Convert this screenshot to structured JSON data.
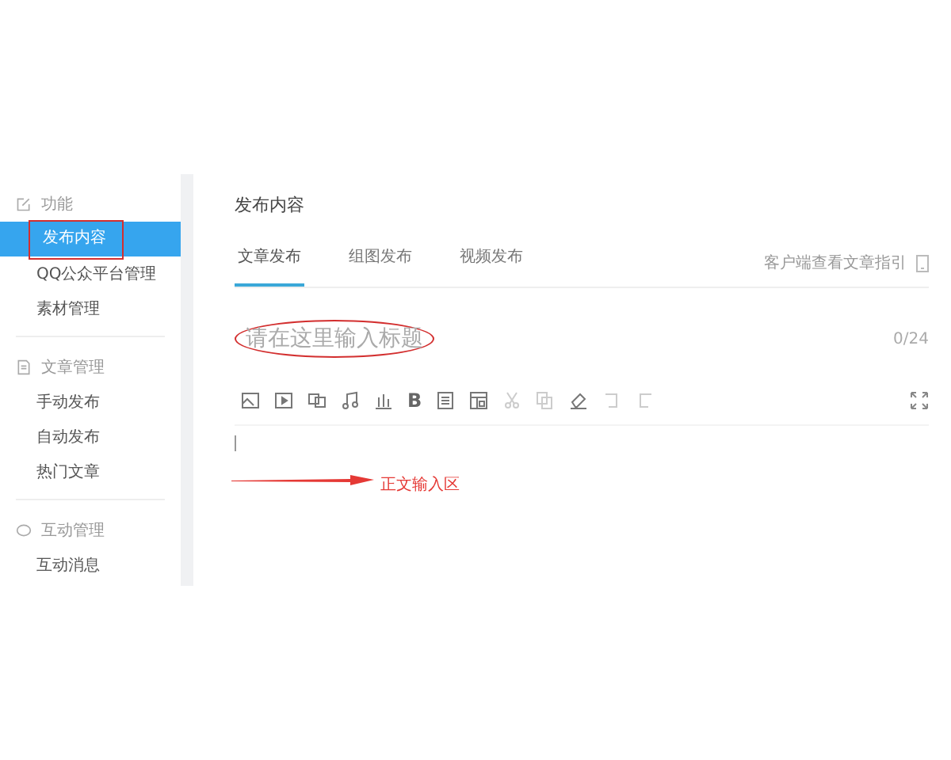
{
  "sidebar": {
    "groups": [
      {
        "label": "功能",
        "kind": "edit",
        "items": [
          {
            "label": "发布内容",
            "selected": true,
            "annotated": true
          },
          {
            "label": "QQ公众平台管理",
            "selected": false,
            "annotated": false
          },
          {
            "label": "素材管理",
            "selected": false,
            "annotated": false
          }
        ]
      },
      {
        "label": "文章管理",
        "kind": "document",
        "items": [
          {
            "label": "手动发布",
            "selected": false,
            "annotated": false
          },
          {
            "label": "自动发布",
            "selected": false,
            "annotated": false
          },
          {
            "label": "热门文章",
            "selected": false,
            "annotated": false
          }
        ]
      },
      {
        "label": "互动管理",
        "kind": "chat",
        "items": [
          {
            "label": "互动消息",
            "selected": false,
            "annotated": false
          }
        ]
      }
    ]
  },
  "main": {
    "title": "发布内容",
    "tabs": [
      {
        "label": "文章发布",
        "selected": true
      },
      {
        "label": "组图发布",
        "selected": false
      },
      {
        "label": "视频发布",
        "selected": false
      }
    ],
    "guide_link": "客户端查看文章指引",
    "title_field": {
      "placeholder": "请在这里输入标题",
      "counter": "0/24",
      "annotated": true
    },
    "toolbar": [
      {
        "kind": "image",
        "disabled": false
      },
      {
        "kind": "video",
        "disabled": false
      },
      {
        "kind": "layers",
        "disabled": false
      },
      {
        "kind": "music",
        "disabled": false
      },
      {
        "kind": "chart",
        "disabled": false
      },
      {
        "kind": "text",
        "label": "B",
        "disabled": false
      },
      {
        "kind": "list",
        "disabled": false
      },
      {
        "kind": "template",
        "disabled": false
      },
      {
        "kind": "cut",
        "disabled": true
      },
      {
        "kind": "copy",
        "disabled": true
      },
      {
        "kind": "eraser",
        "disabled": false
      },
      {
        "kind": "undo",
        "disabled": true
      },
      {
        "kind": "redo",
        "disabled": true
      }
    ],
    "body_annotation": "正文输入区"
  }
}
